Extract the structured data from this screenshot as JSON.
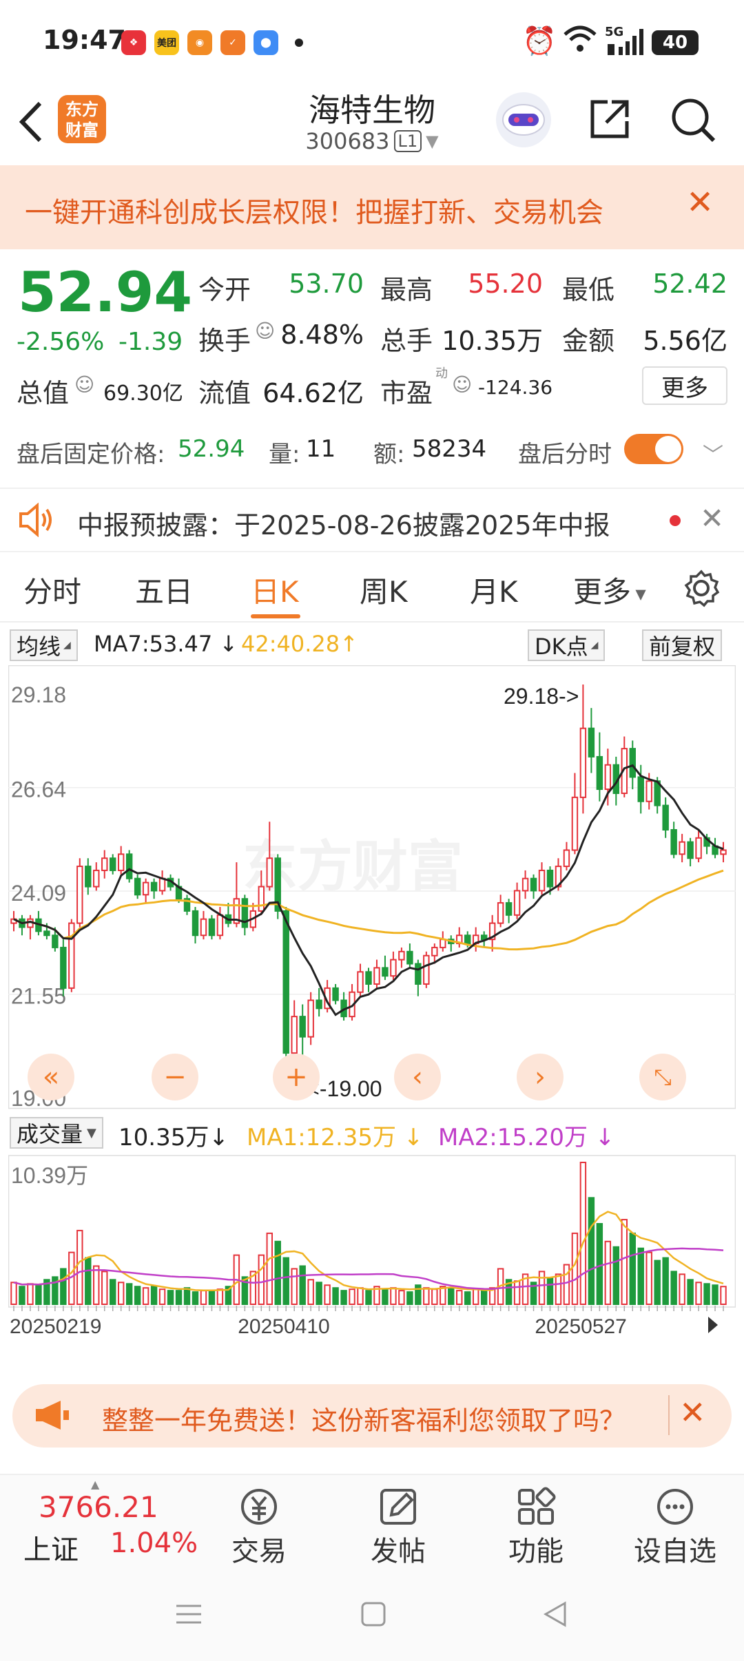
{
  "status_bar": {
    "time": "19:47",
    "network": "5G",
    "battery": "40",
    "app_icons": [
      {
        "name": "app-icon-1",
        "color": "#e8323a"
      },
      {
        "name": "app-icon-meituan",
        "label": "美团",
        "color": "#f8c21c"
      },
      {
        "name": "app-icon-weibo",
        "color": "#f28b24"
      },
      {
        "name": "app-icon-4",
        "color": "#f07a28"
      },
      {
        "name": "app-icon-5",
        "color": "#3f8cf5"
      }
    ]
  },
  "header": {
    "logo_text": "东方财富",
    "stock_name": "海特生物",
    "stock_code": "300683",
    "level_badge": "L1"
  },
  "promo_banner": {
    "text": "一键开通科创成长层权限！把握打新、交易机会"
  },
  "quote": {
    "price": "52.94",
    "change_pct": "-2.56%",
    "change": "-1.39",
    "open_label": "今开",
    "open": "53.70",
    "high_label": "最高",
    "high": "55.20",
    "low_label": "最低",
    "low": "52.42",
    "turnover_label": "换手",
    "turnover": "8.48%",
    "volume_label": "总手",
    "volume": "10.35万",
    "amount_label": "金额",
    "amount": "5.56亿",
    "market_cap_label": "总值",
    "market_cap": "69.30亿",
    "float_cap_label": "流值",
    "float_cap": "64.62亿",
    "pe_label": "市盈",
    "pe_sup": "动",
    "pe": "-124.36",
    "more_label": "更多"
  },
  "after_hours": {
    "price_label": "盘后固定价格:",
    "price": "52.94",
    "vol_label": "量:",
    "vol": "11",
    "amount_label": "额:",
    "amount": "58234",
    "intraday_label": "盘后分时"
  },
  "notice": {
    "text": "中报预披露：于2025-08-26披露2025年中报"
  },
  "period_tabs": [
    "分时",
    "五日",
    "日K",
    "周K",
    "月K",
    "更多"
  ],
  "chart_toolbar": {
    "indicator": "均线",
    "ma7": "MA7:53.47",
    "ma7_arrow": "↓",
    "ma2": "42:40.28",
    "ma2_arrow": "↑",
    "dk": "DK点",
    "adjust": "前复权"
  },
  "volume_toolbar": {
    "label": "成交量",
    "value": "10.35万",
    "value_arrow": "↓",
    "ma1": "MA1:12.35万",
    "ma1_arrow": "↓",
    "ma2": "MA2:15.20万",
    "ma2_arrow": "↓"
  },
  "chart_data": {
    "type": "candlestick",
    "y_ticks": [
      "29.18",
      "26.64",
      "24.09",
      "21.55",
      "19.00"
    ],
    "ylim": [
      19.0,
      29.18
    ],
    "max_label": "29.18->",
    "min_label": "<-19.00",
    "volume_max_label": "10.39万",
    "x_tick_labels": [
      "20250219",
      "20250410",
      "20250527"
    ],
    "watermark": "东方财富",
    "colors": {
      "up": "#e5323a",
      "down": "#1e9a3c",
      "ma_short": "#222222",
      "ma_long": "#f0b323",
      "vol_ma1": "#f0b323",
      "vol_ma2": "#c03ec8"
    },
    "candles": [
      [
        23.3,
        23.6,
        23.1,
        23.4
      ],
      [
        23.4,
        23.5,
        23.0,
        23.2
      ],
      [
        23.2,
        23.5,
        22.9,
        23.4
      ],
      [
        23.4,
        23.6,
        23.0,
        23.1
      ],
      [
        23.1,
        23.3,
        22.9,
        23.0
      ],
      [
        23.0,
        23.2,
        22.6,
        22.7
      ],
      [
        22.7,
        22.9,
        21.5,
        21.7
      ],
      [
        21.7,
        23.4,
        21.6,
        23.3
      ],
      [
        23.3,
        24.9,
        23.2,
        24.7
      ],
      [
        24.7,
        24.9,
        24.0,
        24.2
      ],
      [
        24.2,
        24.8,
        24.1,
        24.6
      ],
      [
        24.6,
        25.1,
        24.4,
        24.9
      ],
      [
        24.9,
        25.0,
        24.5,
        24.6
      ],
      [
        24.6,
        25.2,
        24.5,
        25.0
      ],
      [
        25.0,
        25.1,
        24.3,
        24.4
      ],
      [
        24.4,
        24.5,
        23.9,
        24.0
      ],
      [
        24.0,
        24.4,
        23.8,
        24.3
      ],
      [
        24.3,
        24.4,
        23.9,
        24.1
      ],
      [
        24.1,
        24.6,
        24.0,
        24.4
      ],
      [
        24.4,
        24.5,
        24.1,
        24.2
      ],
      [
        24.2,
        24.4,
        23.8,
        23.9
      ],
      [
        23.9,
        24.0,
        23.5,
        23.6
      ],
      [
        23.6,
        23.7,
        22.8,
        23.0
      ],
      [
        23.0,
        23.6,
        22.9,
        23.4
      ],
      [
        23.4,
        23.5,
        22.9,
        23.0
      ],
      [
        23.0,
        23.7,
        22.9,
        23.5
      ],
      [
        23.5,
        23.8,
        23.2,
        23.3
      ],
      [
        23.3,
        24.8,
        23.2,
        23.9
      ],
      [
        23.9,
        24.0,
        23.0,
        23.2
      ],
      [
        23.2,
        23.8,
        23.1,
        23.6
      ],
      [
        23.6,
        24.6,
        23.5,
        24.2
      ],
      [
        24.2,
        25.8,
        24.1,
        24.9
      ],
      [
        24.9,
        25.0,
        23.4,
        23.6
      ],
      [
        23.6,
        23.7,
        19.8,
        20.1
      ],
      [
        20.1,
        21.4,
        19.6,
        21.0
      ],
      [
        21.0,
        21.3,
        19.0,
        20.5
      ],
      [
        20.5,
        21.6,
        20.3,
        21.4
      ],
      [
        21.4,
        21.7,
        21.0,
        21.2
      ],
      [
        21.2,
        21.9,
        21.1,
        21.7
      ],
      [
        21.7,
        21.8,
        21.3,
        21.4
      ],
      [
        21.4,
        21.6,
        20.9,
        21.0
      ],
      [
        21.0,
        21.8,
        20.9,
        21.6
      ],
      [
        21.6,
        22.3,
        21.5,
        22.1
      ],
      [
        22.1,
        22.2,
        21.6,
        21.8
      ],
      [
        21.8,
        22.4,
        21.7,
        22.2
      ],
      [
        22.2,
        22.5,
        21.9,
        22.0
      ],
      [
        22.0,
        22.6,
        21.9,
        22.4
      ],
      [
        22.4,
        22.7,
        22.2,
        22.6
      ],
      [
        22.6,
        22.8,
        22.2,
        22.3
      ],
      [
        22.3,
        22.4,
        21.5,
        21.8
      ],
      [
        21.8,
        22.6,
        21.7,
        22.5
      ],
      [
        22.5,
        22.8,
        22.3,
        22.7
      ],
      [
        22.7,
        23.1,
        22.6,
        22.9
      ],
      [
        22.9,
        23.0,
        22.6,
        22.8
      ],
      [
        22.8,
        23.2,
        22.7,
        23.0
      ],
      [
        23.0,
        23.1,
        22.7,
        22.8
      ],
      [
        22.8,
        23.2,
        22.6,
        23.0
      ],
      [
        23.0,
        23.1,
        22.7,
        22.9
      ],
      [
        22.9,
        23.5,
        22.6,
        23.3
      ],
      [
        23.3,
        24.0,
        23.2,
        23.8
      ],
      [
        23.8,
        23.9,
        23.3,
        23.5
      ],
      [
        23.5,
        24.3,
        23.4,
        24.1
      ],
      [
        24.1,
        24.6,
        23.9,
        24.4
      ],
      [
        24.4,
        24.5,
        23.9,
        24.1
      ],
      [
        24.1,
        24.8,
        24.0,
        24.6
      ],
      [
        24.6,
        24.7,
        24.0,
        24.2
      ],
      [
        24.2,
        24.9,
        24.1,
        24.7
      ],
      [
        24.7,
        25.3,
        24.6,
        25.1
      ],
      [
        25.1,
        27.0,
        25.0,
        26.4
      ],
      [
        26.4,
        29.18,
        26.0,
        28.1
      ],
      [
        28.1,
        28.6,
        27.0,
        27.4
      ],
      [
        27.4,
        28.0,
        26.3,
        26.6
      ],
      [
        26.6,
        27.6,
        26.2,
        27.2
      ],
      [
        27.2,
        27.4,
        26.2,
        26.5
      ],
      [
        26.5,
        27.9,
        26.4,
        27.6
      ],
      [
        27.6,
        27.8,
        26.6,
        26.9
      ],
      [
        26.9,
        27.2,
        26.0,
        26.3
      ],
      [
        26.3,
        27.0,
        26.1,
        26.8
      ],
      [
        26.8,
        26.9,
        26.0,
        26.2
      ],
      [
        26.2,
        26.4,
        25.4,
        25.6
      ],
      [
        25.6,
        25.8,
        24.9,
        25.0
      ],
      [
        25.0,
        25.5,
        24.8,
        25.3
      ],
      [
        25.3,
        25.4,
        24.7,
        24.9
      ],
      [
        24.9,
        25.6,
        24.8,
        25.4
      ],
      [
        25.4,
        25.5,
        25.0,
        25.2
      ],
      [
        25.2,
        25.4,
        24.9,
        25.0
      ],
      [
        25.0,
        25.3,
        24.8,
        25.1
      ]
    ],
    "volumes": [
      1.6,
      1.3,
      1.5,
      1.4,
      1.8,
      2.0,
      2.6,
      3.8,
      5.4,
      3.4,
      2.8,
      2.4,
      1.8,
      1.6,
      1.5,
      1.3,
      1.2,
      1.3,
      1.1,
      1.0,
      1.0,
      1.2,
      0.9,
      1.0,
      1.0,
      1.1,
      1.3,
      3.6,
      2.0,
      2.4,
      3.6,
      5.2,
      4.6,
      3.4,
      2.6,
      2.8,
      1.8,
      1.6,
      1.4,
      1.2,
      1.0,
      1.1,
      1.2,
      1.0,
      1.3,
      1.1,
      1.2,
      1.0,
      0.9,
      1.4,
      1.2,
      1.1,
      1.3,
      1.2,
      1.0,
      0.9,
      1.1,
      1.0,
      1.2,
      2.6,
      1.8,
      1.7,
      2.2,
      1.6,
      2.4,
      1.9,
      2.2,
      2.9,
      5.2,
      10.39,
      7.8,
      5.9,
      4.6,
      4.2,
      6.2,
      5.2,
      4.1,
      3.8,
      3.2,
      3.4,
      2.4,
      2.2,
      1.8,
      1.6,
      1.5,
      1.4,
      1.3
    ]
  },
  "promo2": {
    "text": "整整一年免费送！这份新客福利您领取了吗？"
  },
  "bottom_nav": {
    "index_value": "3766.21",
    "index_name": "上证",
    "index_change": "1.04%",
    "items": [
      {
        "label": "交易",
        "icon": "yuan-icon",
        "glyph": "¥"
      },
      {
        "label": "发帖",
        "icon": "edit-icon",
        "glyph": "✎"
      },
      {
        "label": "功能",
        "icon": "grid-icon",
        "glyph": "▦"
      },
      {
        "label": "设自选",
        "icon": "more-dots-icon",
        "glyph": "⋯"
      }
    ]
  }
}
